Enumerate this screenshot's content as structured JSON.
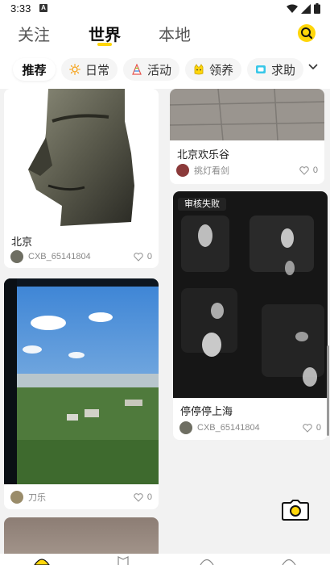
{
  "status": {
    "time": "3:33",
    "notification_letter": "A"
  },
  "nav": {
    "tabs": [
      {
        "label": "关注"
      },
      {
        "label": "世界"
      },
      {
        "label": "本地"
      }
    ],
    "active_tab": "世界",
    "accent": "#ffd60a"
  },
  "chips": [
    {
      "label": "推荐",
      "icon": "none"
    },
    {
      "label": "日常",
      "icon": "sun-icon"
    },
    {
      "label": "活动",
      "icon": "party-hat-icon"
    },
    {
      "label": "领养",
      "icon": "cat-icon"
    },
    {
      "label": "求助",
      "icon": "help-box-icon"
    }
  ],
  "feed": {
    "left": [
      {
        "title": "北京",
        "user": "CXB_65141804",
        "likes": "0",
        "image": "moai-stone-head"
      },
      {
        "title": "",
        "user": "刀乐",
        "likes": "0",
        "image": "window-city-view"
      },
      {
        "title": "",
        "user": "",
        "likes": "",
        "image": "partial-image"
      }
    ],
    "right": [
      {
        "title": "北京欢乐谷",
        "user": "挑灯看剑",
        "likes": "0",
        "image": "pavement-tiles"
      },
      {
        "title": "停停停上海",
        "user": "CXB_65141804",
        "likes": "0",
        "image": "blurry-keyboard",
        "badge": "审核失败"
      }
    ]
  }
}
